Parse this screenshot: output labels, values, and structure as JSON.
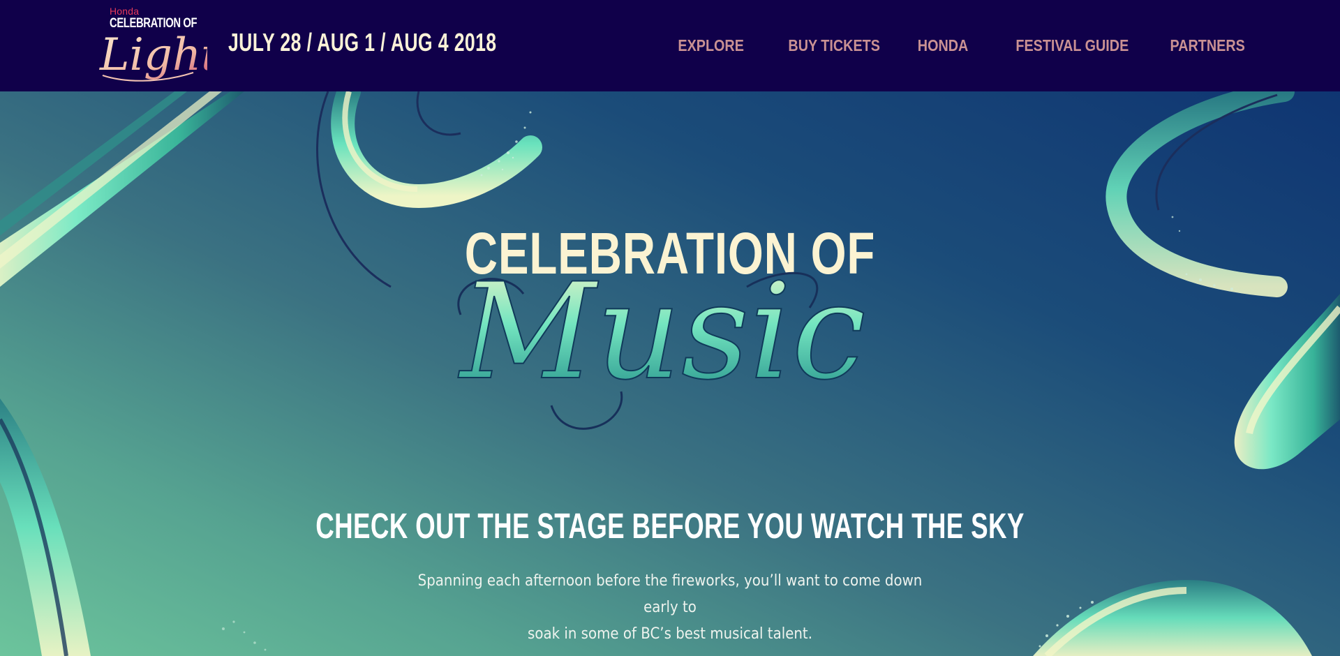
{
  "header": {
    "logo": {
      "brand": "Honda",
      "line1": "CELEBRATION OF",
      "script": "Light"
    },
    "dates": "JULY 28 / AUG 1 / AUG 4 2018",
    "nav": [
      "EXPLORE",
      "BUY TICKETS",
      "HONDA",
      "FESTIVAL GUIDE",
      "PARTNERS"
    ]
  },
  "hero": {
    "title_top": "CELEBRATION OF",
    "title_script": "Music",
    "subheading": "CHECK OUT THE STAGE BEFORE YOU WATCH THE SKY",
    "body_line1": "Spanning each afternoon before the fireworks, you’ll want to come down early to",
    "body_line2": "soak in some of BC’s best musical talent."
  },
  "colors": {
    "header_bg": "#10004a",
    "nav_text": "#c99193",
    "title_cream": "#fbf3d2",
    "brush_mint": "#67e6bf",
    "brand_red": "#e43a5a"
  },
  "icons": [
    "celebration-of-light-logo",
    "brush-stroke-decoration"
  ]
}
